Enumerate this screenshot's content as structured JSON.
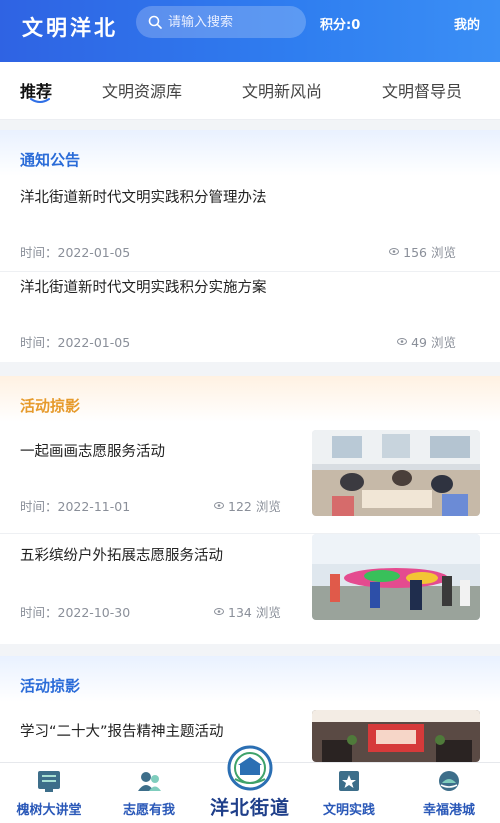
{
  "header": {
    "brand": "文明洋北",
    "search_placeholder": "请输入搜索",
    "points": "积分:0",
    "mine": "我的"
  },
  "tabs": [
    {
      "label": "推荐",
      "active": true
    },
    {
      "label": "文明资源库",
      "active": false
    },
    {
      "label": "文明新风尚",
      "active": false
    },
    {
      "label": "文明督导员",
      "active": false
    }
  ],
  "notice": {
    "title": "通知公告",
    "items": [
      {
        "title": "洋北街道新时代文明实践积分管理办法",
        "time": "时间：2022-01-05",
        "views": "156 浏览"
      },
      {
        "title": "洋北街道新时代文明实践积分实施方案",
        "time": "时间：2022-01-05",
        "views": "49 浏览"
      }
    ]
  },
  "activity": {
    "title": "活动掠影",
    "items": [
      {
        "title": "一起画画志愿服务活动",
        "time": "时间：2022-11-01",
        "views": "122 浏览",
        "image": "classroom-painting-photo"
      },
      {
        "title": "五彩缤纷户外拓展志愿服务活动",
        "time": "时间：2022-10-30",
        "views": "134 浏览",
        "image": "outdoor-parachute-photo"
      }
    ]
  },
  "activity2": {
    "title": "活动掠影",
    "items": [
      {
        "title": "学习“二十大”报告精神主题活动",
        "image": "meeting-room-photo"
      }
    ]
  },
  "bottom_nav": [
    {
      "label": "槐树大讲堂",
      "icon": "lecture-icon"
    },
    {
      "label": "志愿有我",
      "icon": "volunteer-icon"
    },
    {
      "label": "洋北街道",
      "icon": "street-logo"
    },
    {
      "label": "文明实践",
      "icon": "practice-icon"
    },
    {
      "label": "幸福港城",
      "icon": "harbor-icon"
    }
  ],
  "colors": {
    "primary": "#2f6fe6",
    "accent_orange": "#e69a2b",
    "nav_text": "#2a58b8"
  }
}
